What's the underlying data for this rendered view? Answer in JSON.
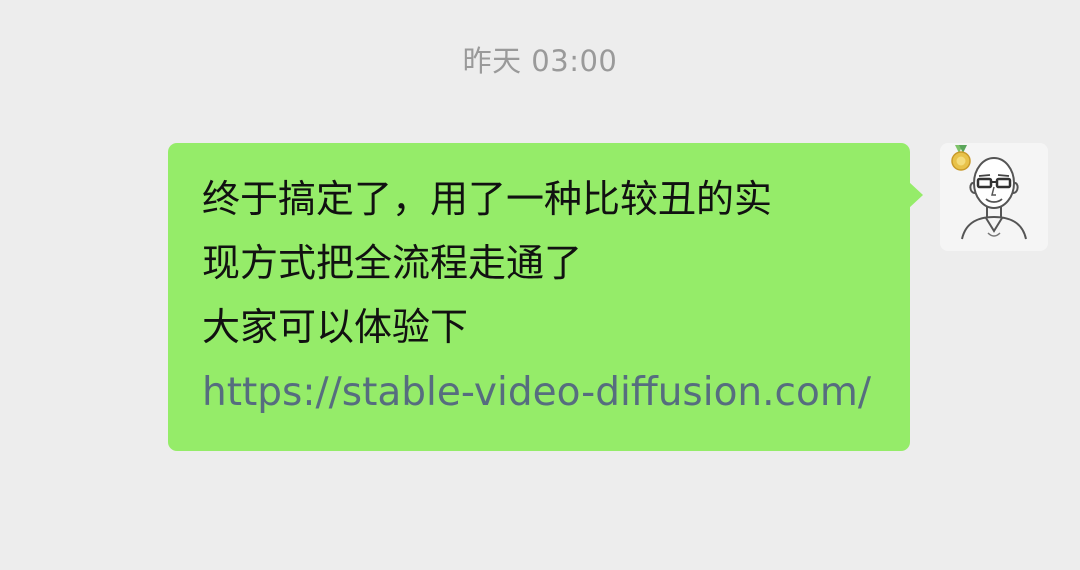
{
  "chat": {
    "timestamp": "昨天 03:00",
    "messages": [
      {
        "side": "outgoing",
        "lines": [
          "终于搞定了，用了一种比较丑的实",
          "现方式把全流程走通了",
          "大家可以体验下"
        ],
        "link": "https://stable-video-diffusion.com/"
      }
    ]
  },
  "colors": {
    "background": "#ededed",
    "bubble": "#95ec69",
    "link": "#566d7f",
    "timestamp": "#9a9a9a"
  },
  "icons": {
    "avatar": "bald-man-with-glasses-avatar-icon",
    "medal": "medal-icon"
  }
}
